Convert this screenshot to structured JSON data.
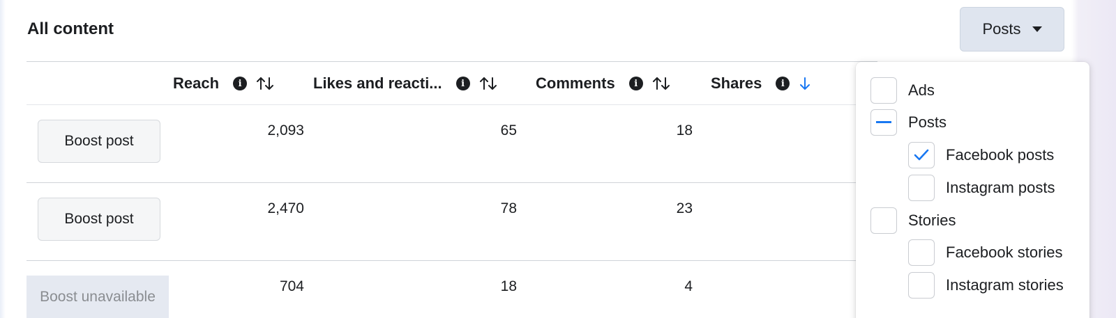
{
  "section_title": "All content",
  "filter": {
    "label": "Posts"
  },
  "table": {
    "columns": [
      {
        "key": "reach",
        "label": "Reach",
        "sort": "none"
      },
      {
        "key": "likes",
        "label": "Likes and reacti...",
        "sort": "none"
      },
      {
        "key": "comments",
        "label": "Comments",
        "sort": "none"
      },
      {
        "key": "shares",
        "label": "Shares",
        "sort": "descending"
      }
    ],
    "rows": [
      {
        "action": "Boost post",
        "action_enabled": true,
        "reach": "2,093",
        "likes": "65",
        "comments": "18"
      },
      {
        "action": "Boost post",
        "action_enabled": true,
        "reach": "2,470",
        "likes": "78",
        "comments": "23"
      },
      {
        "action": "Boost unavailable",
        "action_enabled": false,
        "reach": "704",
        "likes": "18",
        "comments": "4"
      }
    ]
  },
  "dropdown": {
    "options": [
      {
        "label": "Ads",
        "state": "unchecked",
        "level": 0
      },
      {
        "label": "Posts",
        "state": "indeterminate",
        "level": 0
      },
      {
        "label": "Facebook posts",
        "state": "checked",
        "level": 1
      },
      {
        "label": "Instagram posts",
        "state": "unchecked",
        "level": 1
      },
      {
        "label": "Stories",
        "state": "unchecked",
        "level": 0
      },
      {
        "label": "Facebook stories",
        "state": "unchecked",
        "level": 1
      },
      {
        "label": "Instagram stories",
        "state": "unchecked",
        "level": 1
      }
    ]
  },
  "colors": {
    "accent": "#1877f2",
    "text": "#1c1e21",
    "muted": "#8a8d91"
  }
}
